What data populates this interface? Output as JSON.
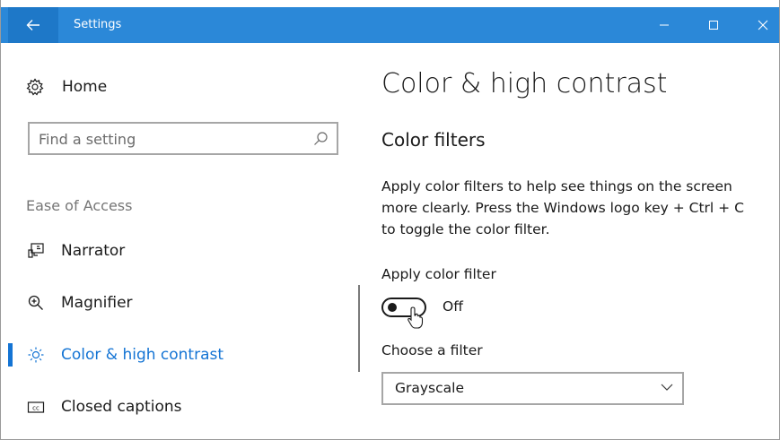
{
  "window": {
    "title": "Settings",
    "accent_color": "#2b88d8"
  },
  "sidebar": {
    "home": {
      "label": "Home",
      "icon": "gear-icon"
    },
    "search": {
      "placeholder": "Find a setting",
      "value": ""
    },
    "section_label": "Ease of Access",
    "items": [
      {
        "label": "Narrator",
        "icon": "narrator-icon",
        "selected": false
      },
      {
        "label": "Magnifier",
        "icon": "magnifier-icon",
        "selected": false
      },
      {
        "label": "Color & high contrast",
        "icon": "brightness-icon",
        "selected": true
      },
      {
        "label": "Closed captions",
        "icon": "closed-captions-icon",
        "selected": false
      }
    ]
  },
  "main": {
    "title": "Color & high contrast",
    "subhead": "Color filters",
    "description": "Apply color filters to help see things on the screen more clearly. Press the Windows logo key + Ctrl + C to toggle the color filter.",
    "toggle": {
      "label": "Apply color filter",
      "state": "Off",
      "on": false
    },
    "filter_select": {
      "label": "Choose a filter",
      "value": "Grayscale"
    }
  },
  "colors": {
    "selected_text": "#1474d4",
    "secondary_text": "#767676"
  }
}
